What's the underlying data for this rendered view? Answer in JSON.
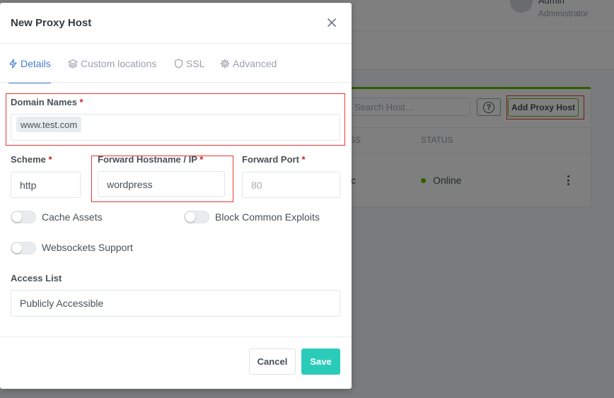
{
  "background": {
    "user": {
      "name": "Admin",
      "role": "Administrator"
    },
    "search_placeholder": "Search Host…",
    "help_icon": "question-circle-icon",
    "add_button_label": "Add Proxy Host",
    "table": {
      "headers": [
        "SS",
        "STATUS"
      ],
      "row": {
        "source_fragment": "c",
        "status": "Online"
      }
    },
    "colors": {
      "accent_green": "#5eba00",
      "status_online": "#5eba00"
    }
  },
  "modal": {
    "title": "New Proxy Host",
    "close_icon": "close-icon",
    "tabs": [
      {
        "label": "Details",
        "icon": "bolt-icon",
        "active": true
      },
      {
        "label": "Custom locations",
        "icon": "layers-icon",
        "active": false
      },
      {
        "label": "SSL",
        "icon": "shield-icon",
        "active": false
      },
      {
        "label": "Advanced",
        "icon": "gear-icon",
        "active": false
      }
    ],
    "domain_names": {
      "label": "Domain Names",
      "required_mark": "*",
      "tags": [
        "www.test.com"
      ]
    },
    "scheme": {
      "label": "Scheme",
      "required_mark": "*",
      "value": "http"
    },
    "forward_host": {
      "label": "Forward Hostname / IP",
      "required_mark": "*",
      "value": "wordpress"
    },
    "forward_port": {
      "label": "Forward Port",
      "required_mark": "*",
      "value": "",
      "placeholder": "80"
    },
    "toggles": {
      "cache_assets": {
        "label": "Cache Assets",
        "on": false
      },
      "block_exploits": {
        "label": "Block Common Exploits",
        "on": false
      },
      "websockets": {
        "label": "Websockets Support",
        "on": false
      }
    },
    "access_list": {
      "label": "Access List",
      "value": "Publicly Accessible"
    },
    "buttons": {
      "cancel": "Cancel",
      "save": "Save"
    },
    "colors": {
      "primary": "#467fcf",
      "save": "#2bcbba",
      "required": "#cd201f",
      "highlight": "#e53935"
    }
  }
}
